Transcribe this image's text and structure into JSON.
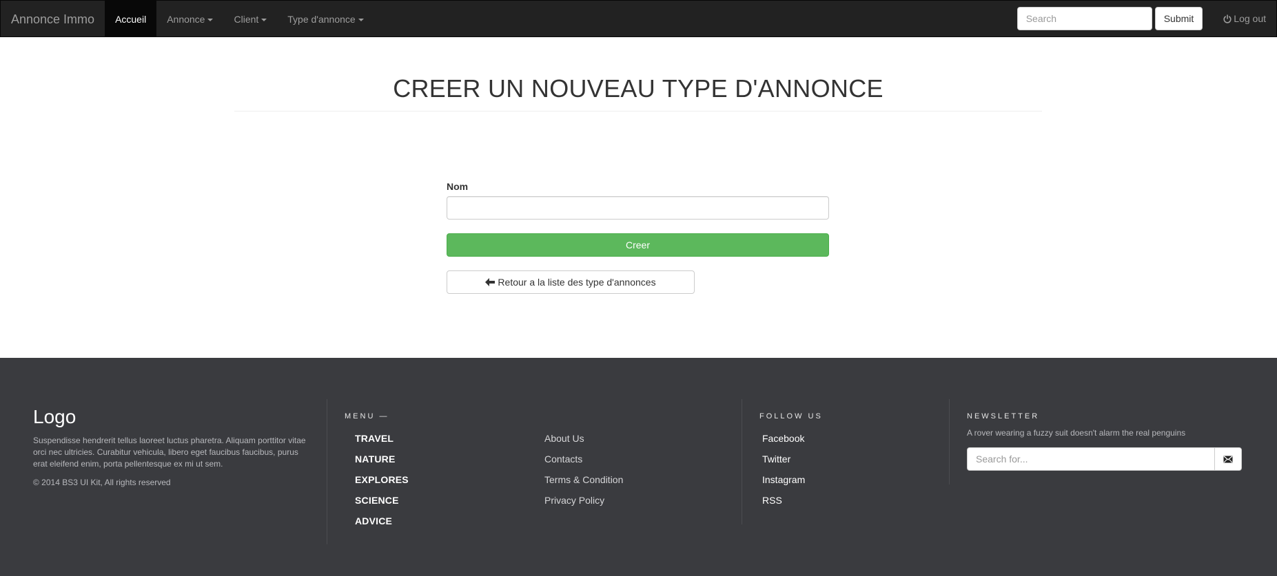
{
  "navbar": {
    "brand": "Annonce Immo",
    "items": [
      {
        "label": "Accueil",
        "active": true,
        "dropdown": false
      },
      {
        "label": "Annonce",
        "active": false,
        "dropdown": true
      },
      {
        "label": "Client",
        "active": false,
        "dropdown": true
      },
      {
        "label": "Type d'annonce",
        "active": false,
        "dropdown": true
      }
    ],
    "search_placeholder": "Search",
    "submit_label": "Submit",
    "logout_label": "Log out",
    "logout_icon": "power-icon"
  },
  "main": {
    "title": "CREER UN NOUVEAU TYPE D'ANNONCE",
    "form": {
      "name_label": "Nom",
      "name_value": "",
      "create_label": "Creer",
      "back_label": "Retour a la liste des type d'annonces",
      "back_icon": "arrow-left-icon"
    }
  },
  "footer": {
    "logo": "Logo",
    "about_text": "Suspendisse hendrerit tellus laoreet luctus pharetra. Aliquam porttitor vitae orci nec ultricies. Curabitur vehicula, libero eget faucibus faucibus, purus erat eleifend enim, porta pellentesque ex mi ut sem.",
    "copyright": "© 2014 BS3 UI Kit, All rights reserved",
    "menu_heading": "MENU —",
    "menu_items": [
      "TRAVEL",
      "NATURE",
      "EXPLORES",
      "SCIENCE",
      "ADVICE"
    ],
    "info_links": [
      "About Us",
      "Contacts",
      "Terms & Condition",
      "Privacy Policy"
    ],
    "follow_heading": "FOLLOW US",
    "follow_links": [
      "Facebook",
      "Twitter",
      "Instagram",
      "RSS"
    ],
    "newsletter_heading": "NEWSLETTER",
    "newsletter_text": "A rover wearing a fuzzy suit doesn't alarm the real penguins",
    "newsletter_placeholder": "Search for...",
    "newsletter_icon": "envelope-icon"
  },
  "colors": {
    "navbar_bg": "#222222",
    "active_bg": "#080808",
    "success": "#5cb85c",
    "footer_bg": "#3a3b3f"
  }
}
